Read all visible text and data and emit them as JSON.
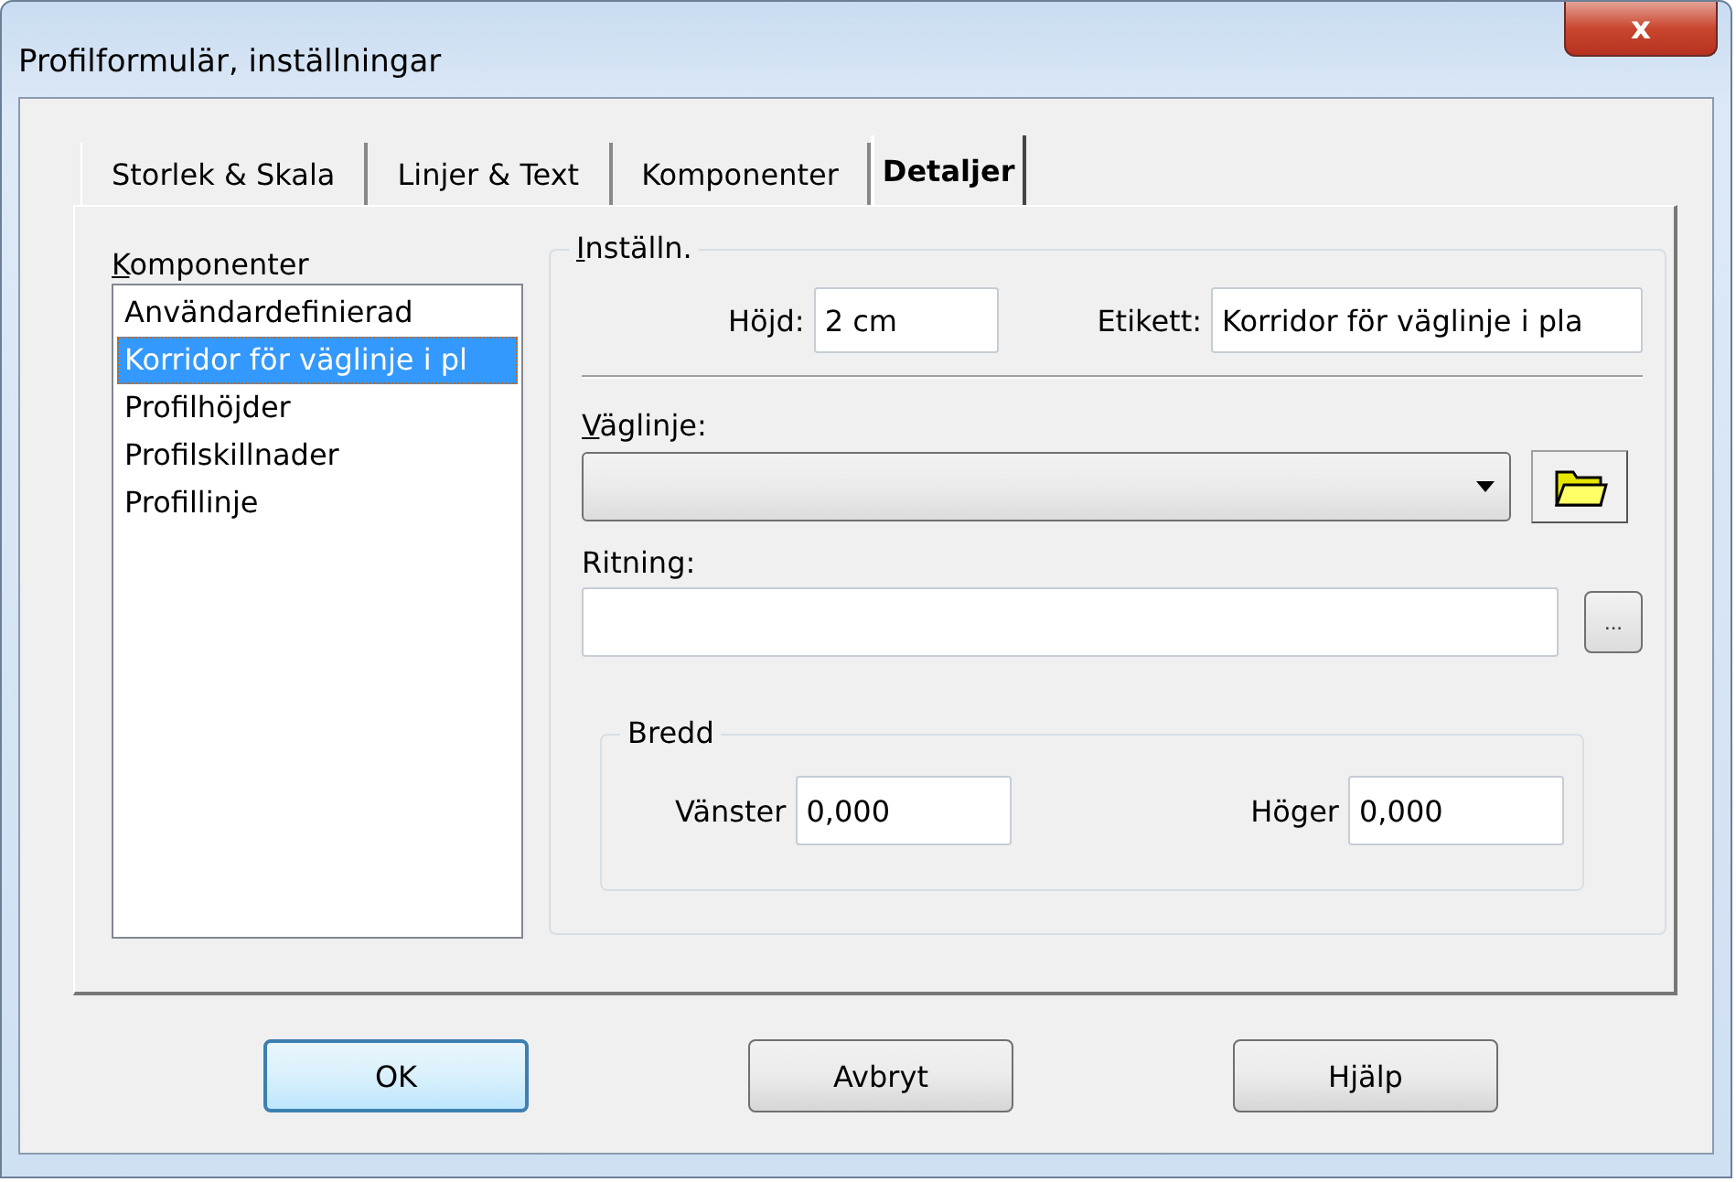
{
  "window": {
    "title": "Profilformulär, inställningar",
    "close": "x"
  },
  "tabs": [
    {
      "label": "Storlek & Skala",
      "selected": false
    },
    {
      "label": "Linjer & Text",
      "selected": false
    },
    {
      "label": "Komponenter",
      "selected": false
    },
    {
      "label": "Detaljer",
      "selected": true
    }
  ],
  "components": {
    "label": "Komponenter",
    "items": [
      {
        "label": "Användardefinierad",
        "selected": false
      },
      {
        "label": "Korridor för väglinje i pl",
        "selected": true
      },
      {
        "label": "Profilhöjder",
        "selected": false
      },
      {
        "label": "Profilskillnader",
        "selected": false
      },
      {
        "label": "Profillinje",
        "selected": false
      }
    ]
  },
  "settings": {
    "title": "Inställn.",
    "height_label": "Höjd:",
    "height_value": "2 cm",
    "tag_label": "Etikett:",
    "tag_value": "Korridor för väglinje i pla",
    "road_line_label": "Väglinje:",
    "drawing_label": "Ritning:",
    "browse": "...",
    "width": {
      "title": "Bredd",
      "left_label": "Vänster",
      "left_value": "0,000",
      "right_label": "Höger",
      "right_value": "0,000"
    }
  },
  "buttons": [
    {
      "label": "OK",
      "focused": true
    },
    {
      "label": "Avbryt",
      "focused": false
    },
    {
      "label": "Hjälp",
      "focused": false
    }
  ]
}
